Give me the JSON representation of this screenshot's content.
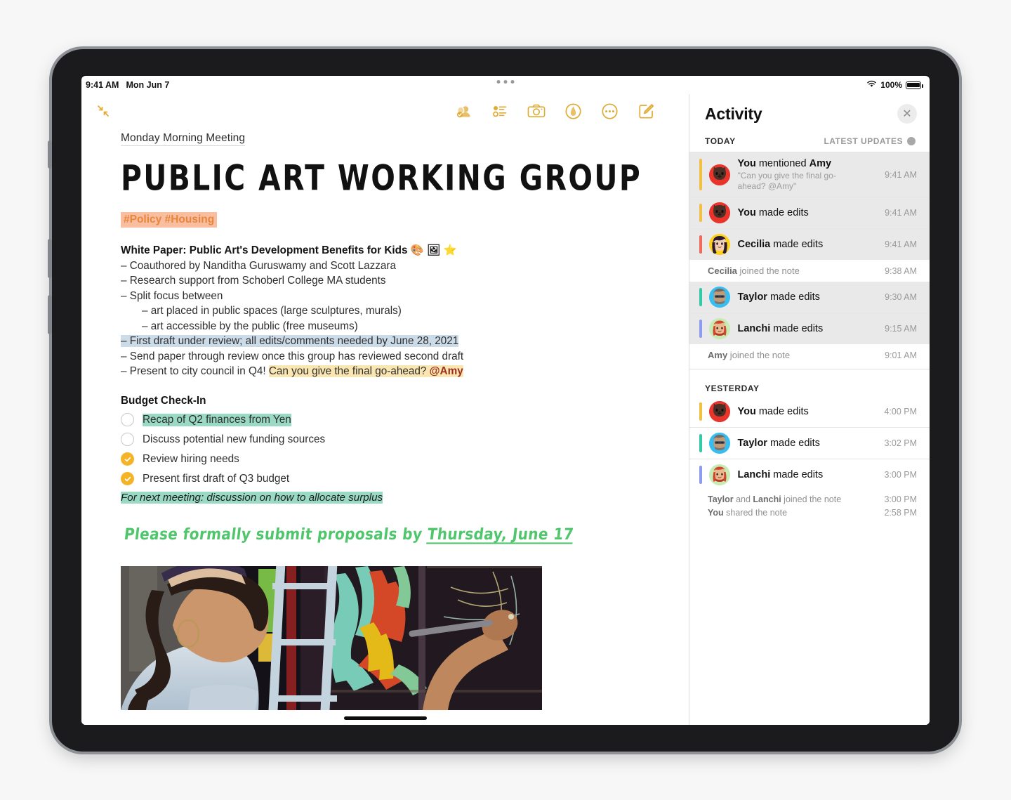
{
  "status_bar": {
    "time": "9:41 AM",
    "date": "Mon Jun 7",
    "battery_percent": "100%",
    "wifi_icon": "wifi-icon",
    "battery_icon": "battery-icon",
    "multitask_icon": "multitask-dots-icon"
  },
  "note_toolbar": {
    "collapse_icon": "collapse-arrows-icon",
    "icons": [
      {
        "name": "share-collaborate-icon",
        "label": "Collaborate"
      },
      {
        "name": "checklist-icon",
        "label": "Checklist"
      },
      {
        "name": "camera-icon",
        "label": "Camera"
      },
      {
        "name": "markup-pen-icon",
        "label": "Markup"
      },
      {
        "name": "more-ellipsis-icon",
        "label": "More"
      },
      {
        "name": "compose-icon",
        "label": "Compose"
      }
    ]
  },
  "note": {
    "subtitle": "Monday Morning Meeting",
    "title": "PUBLIC ART WORKING GROUP",
    "tags": "#Policy #Housing",
    "white_paper_heading": "White Paper: Public Art's Development Benefits for Kids 🎨 🖼 ⭐",
    "bullets": [
      "– Coauthored by Nanditha Guruswamy and Scott Lazzara",
      "– Research support from Schoberl College MA students",
      "– Split focus between"
    ],
    "sub_bullets": [
      "– art placed in public spaces (large sculptures, murals)",
      "– art accessible by the public (free museums)"
    ],
    "highlighted_bullet": "– First draft under review; all edits/comments needed by June 28, 2021",
    "bullets_after": [
      "– Send paper through review once this group has reviewed second draft"
    ],
    "q4_prefix": "– Present to city council in Q4! ",
    "q4_highlight": "Can you give the final go-ahead? ",
    "q4_mention": "@Amy",
    "budget_heading": "Budget Check-In",
    "todos": [
      {
        "label": "Recap of Q2 finances from Yen",
        "done": false,
        "highlight": true
      },
      {
        "label": "Discuss potential new funding sources",
        "done": false,
        "highlight": false
      },
      {
        "label": "Review hiring needs",
        "done": true,
        "highlight": false
      },
      {
        "label": "Present first draft of Q3 budget",
        "done": true,
        "highlight": false
      }
    ],
    "next_meeting_note": "For next meeting: discussion on how to allocate surplus",
    "handwriting_prefix": "Please formally submit proposals by ",
    "handwriting_underlined": "Thursday, June 17",
    "photo_alt": "woman-painting-mural-photo"
  },
  "activity": {
    "title": "Activity",
    "close_icon": "close-icon",
    "today_label": "TODAY",
    "latest_updates_label": "LATEST UPDATES",
    "latest_updates_icon": "clock-icon",
    "yesterday_label": "YESTERDAY",
    "today_items": [
      {
        "actor": "You",
        "action": " mentioned ",
        "target": "Amy",
        "quote": "\"Can you give the final go-ahead? @Amy\"",
        "time": "9:41 AM",
        "bar_color": "#f3c141",
        "avatar_bg": "#e8342b",
        "highlighted": true,
        "type": "edit"
      },
      {
        "actor": "You",
        "action": " made edits",
        "target": "",
        "quote": "",
        "time": "9:41 AM",
        "bar_color": "#f3c141",
        "avatar_bg": "#e8342b",
        "highlighted": true,
        "type": "edit"
      },
      {
        "actor": "Cecilia",
        "action": " made edits",
        "target": "",
        "quote": "",
        "time": "9:41 AM",
        "bar_color": "#f26a5a",
        "avatar_bg": "#ffd11a",
        "highlighted": true,
        "type": "edit"
      },
      {
        "actor": "Cecilia",
        "action": " joined the note",
        "target": "",
        "quote": "",
        "time": "9:38 AM",
        "bar_color": "",
        "avatar_bg": "",
        "highlighted": false,
        "type": "join"
      },
      {
        "actor": "Taylor",
        "action": " made edits",
        "target": "",
        "quote": "",
        "time": "9:30 AM",
        "bar_color": "#34c9a8",
        "avatar_bg": "#37bdf0",
        "highlighted": true,
        "type": "edit"
      },
      {
        "actor": "Lanchi",
        "action": " made edits",
        "target": "",
        "quote": "",
        "time": "9:15 AM",
        "bar_color": "#8d9bf0",
        "avatar_bg": "#c6ecb4",
        "highlighted": true,
        "type": "edit"
      },
      {
        "actor": "Amy",
        "action": " joined the note",
        "target": "",
        "quote": "",
        "time": "9:01 AM",
        "bar_color": "",
        "avatar_bg": "",
        "highlighted": false,
        "type": "join"
      }
    ],
    "yesterday_items": [
      {
        "actor": "You",
        "action": " made edits",
        "target": "",
        "quote": "",
        "time": "4:00 PM",
        "bar_color": "#f3c141",
        "avatar_bg": "#e8342b",
        "highlighted": false,
        "type": "edit"
      },
      {
        "actor": "Taylor",
        "action": " made edits",
        "target": "",
        "quote": "",
        "time": "3:02 PM",
        "bar_color": "#34c9a8",
        "avatar_bg": "#37bdf0",
        "highlighted": false,
        "type": "edit"
      },
      {
        "actor": "Lanchi",
        "action": " made edits",
        "target": "",
        "quote": "",
        "time": "3:00 PM",
        "bar_color": "#8d9bf0",
        "avatar_bg": "#c6ecb4",
        "highlighted": false,
        "type": "edit"
      }
    ],
    "tail_lines": [
      {
        "bold1": "Taylor",
        "mid": " and ",
        "bold2": "Lanchi",
        "rest": " joined the note",
        "time": "3:00 PM"
      },
      {
        "bold1": "You",
        "mid": "",
        "bold2": "",
        "rest": " shared the note",
        "time": "2:58 PM"
      }
    ]
  },
  "colors": {
    "accent_yellow": "#e0aa33",
    "tag_bg": "#f9bda0",
    "tag_text": "#e8863c",
    "highlight_blue": "#ccdbe8",
    "highlight_yellow": "#fae6b1",
    "highlight_green": "#9ad9c4",
    "mention_red": "#9c2f22",
    "handwriting_green": "#4fc66b",
    "checkbox_done": "#f5b427"
  }
}
